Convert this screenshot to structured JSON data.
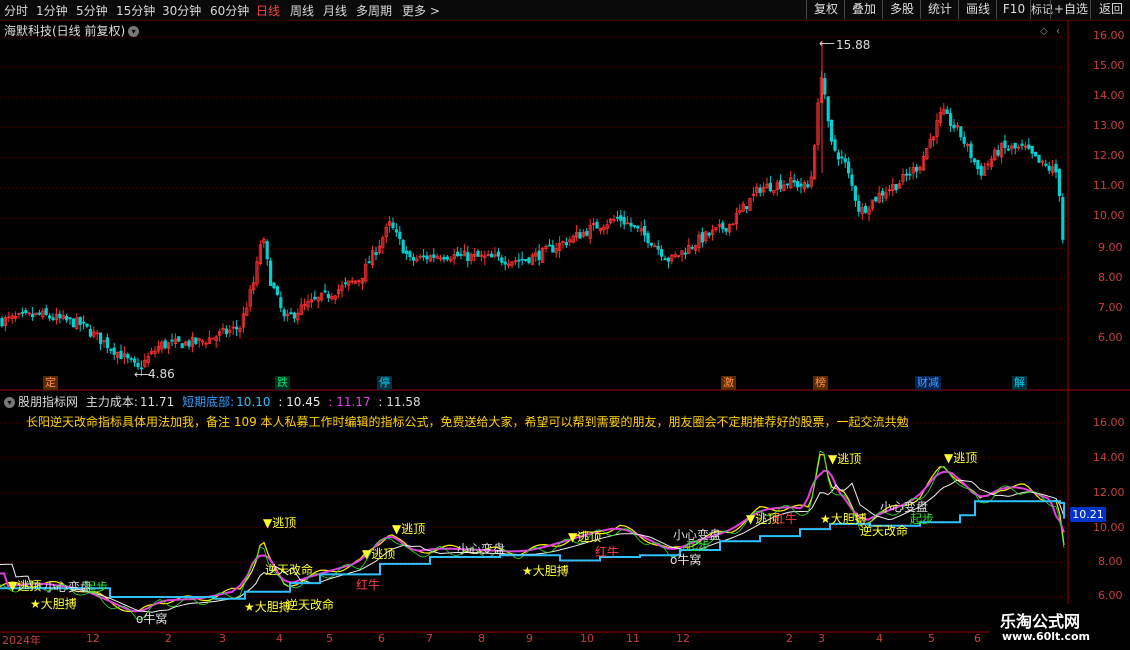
{
  "toolbar": {
    "periods": [
      "分时",
      "1分钟",
      "5分钟",
      "15分钟",
      "30分钟",
      "60分钟",
      "日线",
      "周线",
      "月线",
      "多周期",
      "更多 >"
    ],
    "active_period": "日线",
    "right_buttons": [
      "复权",
      "叠加",
      "多股",
      "统计",
      "画线",
      "F10",
      "标记",
      "+自选",
      "返回"
    ]
  },
  "main_chart": {
    "title": "海默科技(日线 前复权)",
    "high_label": "15.88",
    "low_label": "4.86",
    "y_ticks": [
      "16.00",
      "15.00",
      "14.00",
      "13.00",
      "12.00",
      "11.00",
      "10.00",
      "9.00",
      "8.00",
      "7.00",
      "6.00"
    ],
    "event_tags": [
      {
        "text": "定",
        "color": "#e07020"
      },
      {
        "text": "跌",
        "color": "#00c060"
      },
      {
        "text": "停",
        "color": "#00a0c0"
      },
      {
        "text": "激",
        "color": "#e07020"
      },
      {
        "text": "榜",
        "color": "#e07020"
      },
      {
        "text": "财减",
        "color": "#2090ff"
      },
      {
        "text": "解",
        "color": "#00a0c0"
      }
    ]
  },
  "indicator": {
    "name": "股朋指标网",
    "main_cost_label": "主力成本:",
    "main_cost_value": "11.71",
    "short_bottom_label": "短期底部:",
    "short_bottom_value": "10.10",
    "v3": ": 10.45",
    "v4": ": 11.17",
    "v5": ": 11.58",
    "note": "长阳逆天改命指标具体用法加我，备注 109 本人私募工作时编辑的指标公式，免费送给大家，希望可以帮到需要的朋友，朋友圈会不定期推荐好的股票，一起交流共勉",
    "y_ticks": [
      "16.00",
      "14.00",
      "12.00",
      "10.00",
      "8.00",
      "6.00"
    ],
    "price_box": "10.21",
    "signals": {
      "escape": "▼逃顶",
      "bold": "★大胆搏",
      "nest": "o牛窝",
      "change": "小心变盘",
      "fate": "逆天改命",
      "red": "红牛",
      "start": "起步"
    }
  },
  "x_axis": [
    "2024年",
    "12",
    "2",
    "3",
    "4",
    "5",
    "6",
    "7",
    "8",
    "9",
    "10",
    "11",
    "12",
    "2",
    "3",
    "4",
    "5",
    "6"
  ],
  "watermark": {
    "line1": "乐淘公式网",
    "line2": "www.60lt.com"
  }
}
